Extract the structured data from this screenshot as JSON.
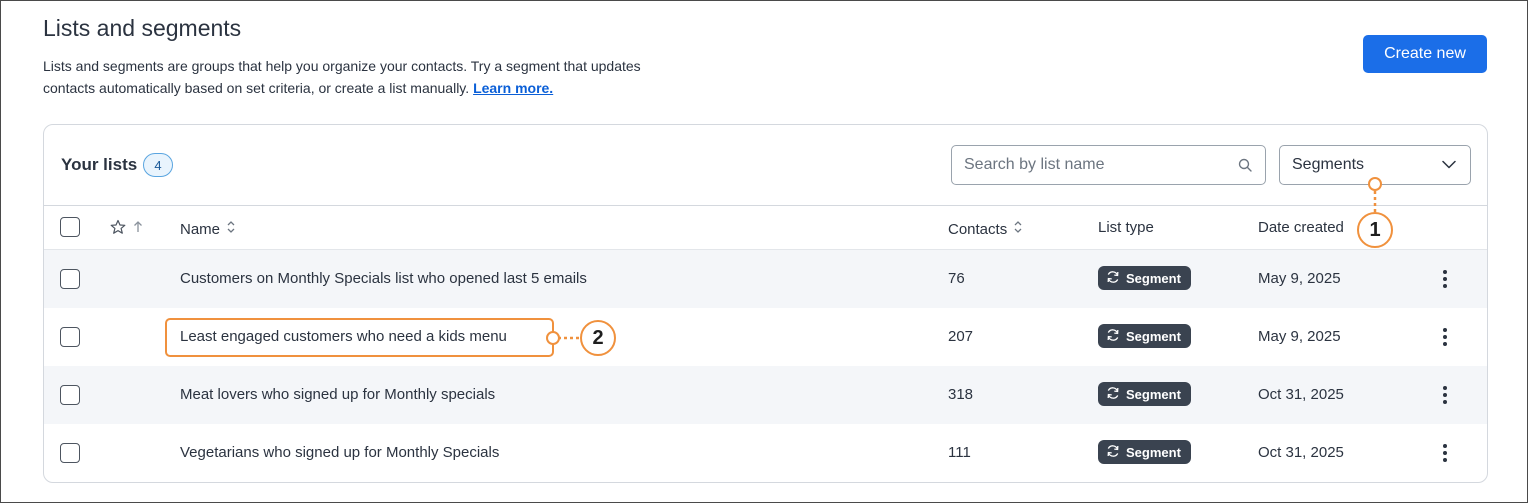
{
  "page": {
    "title": "Lists and segments",
    "description": "Lists and segments are groups that help you organize your contacts. Try a segment that updates contacts automatically based on set criteria, or create a list manually.",
    "learn_more": "Learn more.",
    "create_button": "Create new"
  },
  "lists_card": {
    "title": "Your lists",
    "count": "4",
    "search": {
      "placeholder": "Search by list name",
      "value": ""
    },
    "filter": {
      "selected": "Segments"
    },
    "columns": {
      "name": "Name",
      "contacts": "Contacts",
      "list_type": "List type",
      "date_created": "Date created"
    },
    "rows": [
      {
        "name": "Customers on Monthly Specials list who opened last 5 emails",
        "contacts": "76",
        "type": "Segment",
        "date": "May 9, 2025"
      },
      {
        "name": "Least engaged customers who need a kids menu",
        "contacts": "207",
        "type": "Segment",
        "date": "May 9, 2025"
      },
      {
        "name": "Meat lovers who signed up for Monthly specials",
        "contacts": "318",
        "type": "Segment",
        "date": "Oct 31, 2025"
      },
      {
        "name": "Vegetarians who signed up for Monthly Specials",
        "contacts": "111",
        "type": "Segment",
        "date": "Oct 31, 2025"
      }
    ]
  },
  "callouts": {
    "one": "1",
    "two": "2"
  },
  "icons": {
    "search": "search-icon",
    "chevron": "chevron-down-icon",
    "star": "star-icon",
    "sort": "sort-icon",
    "segment": "refresh-icon",
    "menu": "kebab-menu-icon"
  },
  "colors": {
    "primary": "#1b6ee8",
    "badge_dark": "#3a4350",
    "callout": "#f0913d",
    "row_shade": "#f4f6f9"
  }
}
